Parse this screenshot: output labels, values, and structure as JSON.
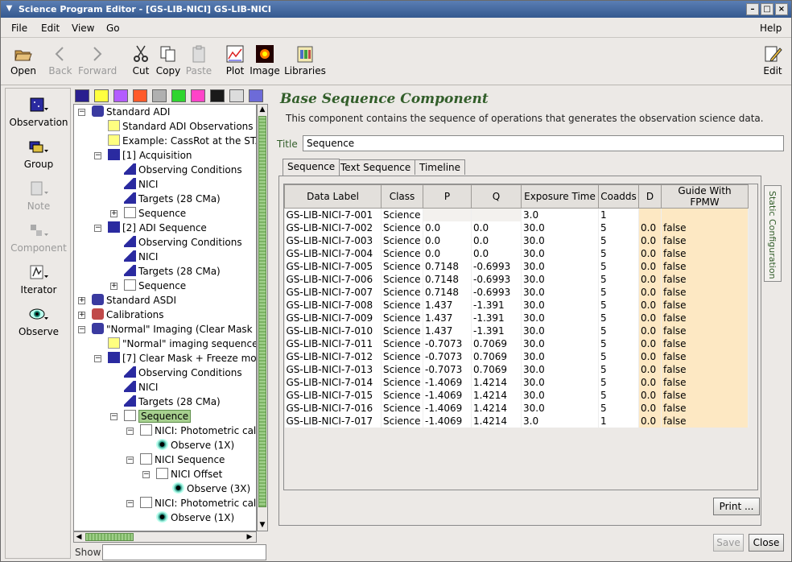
{
  "window": {
    "title": "Science Program Editor - [GS-LIB-NICI] GS-LIB-NICI"
  },
  "menubar": {
    "file": "File",
    "edit": "Edit",
    "view": "View",
    "go": "Go",
    "help": "Help"
  },
  "toolbar": {
    "open": "Open",
    "back": "Back",
    "forward": "Forward",
    "cut": "Cut",
    "copy": "Copy",
    "paste": "Paste",
    "plot": "Plot",
    "image": "Image",
    "libraries": "Libraries",
    "edit": "Edit"
  },
  "palette": {
    "observation": "Observation",
    "group": "Group",
    "note": "Note",
    "component": "Component",
    "iterator": "Iterator",
    "observe": "Observe"
  },
  "colors": [
    "#2a1f8f",
    "#ffff40",
    "#b35cff",
    "#ff5a2a",
    "#b0b0b0",
    "#2fd52f",
    "#ff44c8",
    "#1a1a1a",
    "#dcdcdc",
    "#6d6bd8"
  ],
  "tree": {
    "n1": "Standard ADI",
    "n2": "Standard ADI Observations w",
    "n3": "Example: CassRot at the STA",
    "n4": "[1] Acquisition",
    "n5": "Observing Conditions",
    "n6": "NICI",
    "n7": "Targets (28 CMa)",
    "n8": "Sequence",
    "n9": "[2] ADI Sequence",
    "n10": "Observing Conditions",
    "n11": "NICI",
    "n12": "Targets (28 CMa)",
    "n13": "Sequence",
    "n14": "Standard ASDI",
    "n15": "Calibrations",
    "n16": "\"Normal\" Imaging (Clear Mask +",
    "n17": "\"Normal\" imaging sequence",
    "n18": "[7] Clear Mask + Freeze mo",
    "n19": "Observing Conditions",
    "n20": "NICI",
    "n21": "Targets (28 CMa)",
    "n22": "Sequence",
    "n23": "NICI: Photometric cali",
    "n24": "Observe (1X)",
    "n25": "NICI Sequence",
    "n26": "NICI Offset",
    "n27": "Observe (3X)",
    "n28": "NICI: Photometric cali",
    "n29": "Observe (1X)"
  },
  "show": {
    "label": "Show",
    "value": ""
  },
  "component": {
    "title": "Base Sequence Component",
    "description": "This component contains the sequence of operations that generates the observation science data.",
    "title_label": "Title",
    "title_value": "Sequence",
    "tabs": [
      "Sequence",
      "Text Sequence",
      "Timeline"
    ],
    "side_tab": "Static Configuration",
    "columns": [
      "Data Label",
      "Class",
      "P",
      "Q",
      "Exposure Time",
      "Coadds",
      "D",
      "Guide With FPMW"
    ],
    "rows": [
      [
        "GS-LIB-NICI-7-001",
        "Science",
        "",
        "",
        "3.0",
        "1",
        "",
        ""
      ],
      [
        "GS-LIB-NICI-7-002",
        "Science",
        "0.0",
        "0.0",
        "30.0",
        "5",
        "0.0",
        "false"
      ],
      [
        "GS-LIB-NICI-7-003",
        "Science",
        "0.0",
        "0.0",
        "30.0",
        "5",
        "0.0",
        "false"
      ],
      [
        "GS-LIB-NICI-7-004",
        "Science",
        "0.0",
        "0.0",
        "30.0",
        "5",
        "0.0",
        "false"
      ],
      [
        "GS-LIB-NICI-7-005",
        "Science",
        "0.7148",
        "-0.6993",
        "30.0",
        "5",
        "0.0",
        "false"
      ],
      [
        "GS-LIB-NICI-7-006",
        "Science",
        "0.7148",
        "-0.6993",
        "30.0",
        "5",
        "0.0",
        "false"
      ],
      [
        "GS-LIB-NICI-7-007",
        "Science",
        "0.7148",
        "-0.6993",
        "30.0",
        "5",
        "0.0",
        "false"
      ],
      [
        "GS-LIB-NICI-7-008",
        "Science",
        "1.437",
        "-1.391",
        "30.0",
        "5",
        "0.0",
        "false"
      ],
      [
        "GS-LIB-NICI-7-009",
        "Science",
        "1.437",
        "-1.391",
        "30.0",
        "5",
        "0.0",
        "false"
      ],
      [
        "GS-LIB-NICI-7-010",
        "Science",
        "1.437",
        "-1.391",
        "30.0",
        "5",
        "0.0",
        "false"
      ],
      [
        "GS-LIB-NICI-7-011",
        "Science",
        "-0.7073",
        "0.7069",
        "30.0",
        "5",
        "0.0",
        "false"
      ],
      [
        "GS-LIB-NICI-7-012",
        "Science",
        "-0.7073",
        "0.7069",
        "30.0",
        "5",
        "0.0",
        "false"
      ],
      [
        "GS-LIB-NICI-7-013",
        "Science",
        "-0.7073",
        "0.7069",
        "30.0",
        "5",
        "0.0",
        "false"
      ],
      [
        "GS-LIB-NICI-7-014",
        "Science",
        "-1.4069",
        "1.4214",
        "30.0",
        "5",
        "0.0",
        "false"
      ],
      [
        "GS-LIB-NICI-7-015",
        "Science",
        "-1.4069",
        "1.4214",
        "30.0",
        "5",
        "0.0",
        "false"
      ],
      [
        "GS-LIB-NICI-7-016",
        "Science",
        "-1.4069",
        "1.4214",
        "30.0",
        "5",
        "0.0",
        "false"
      ],
      [
        "GS-LIB-NICI-7-017",
        "Science",
        "-1.4069",
        "1.4214",
        "3.0",
        "1",
        "0.0",
        "false"
      ]
    ],
    "print": "Print ..."
  },
  "footer": {
    "save": "Save",
    "close": "Close"
  }
}
